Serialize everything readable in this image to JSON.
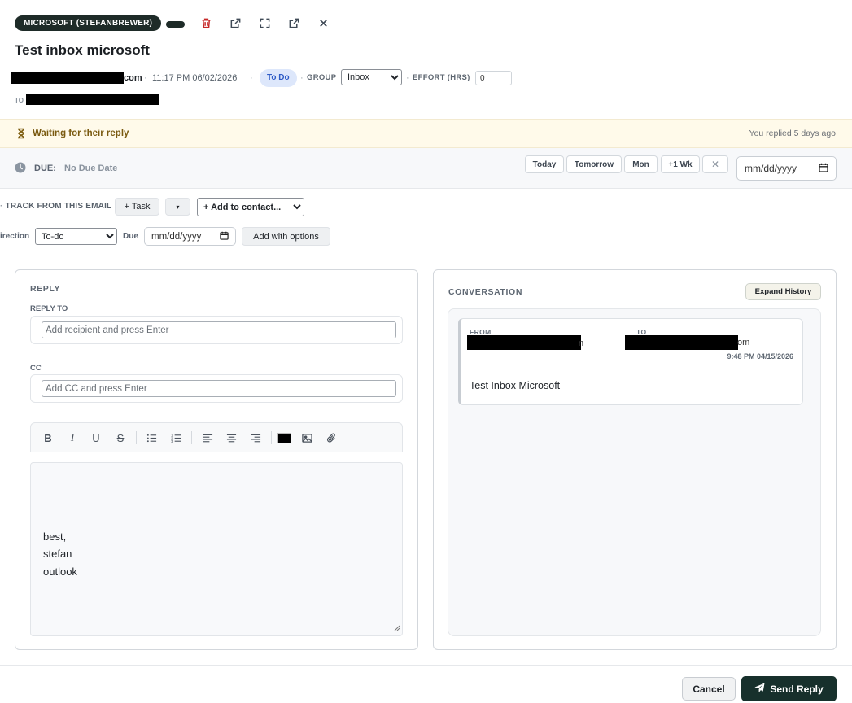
{
  "header": {
    "account_label": "MICROSOFT (STEFANBREWER)",
    "subject": "Test inbox microsoft",
    "sender_suffix": "com",
    "sent_time": "11:17 PM 06/02/2026",
    "status": "To Do",
    "group_label": "GROUP",
    "group_value": "Inbox",
    "group_options": [
      "Inbox"
    ],
    "effort_label": "EFFORT (HRS)",
    "effort_value": "0",
    "to_label": "TO"
  },
  "icons": [
    "delete-icon",
    "open-external-icon",
    "fullscreen-icon",
    "popout-icon",
    "close-icon"
  ],
  "banner": {
    "text": "Waiting for their reply",
    "right_text": "You replied 5 days ago",
    "color": "#7a5a10",
    "background": "#fffaea"
  },
  "due": {
    "label": "DUE:",
    "value": "No Due Date",
    "quick_buttons": [
      "Today",
      "Tomorrow",
      "Mon",
      "+1 Wk"
    ],
    "clear_symbol": "✕",
    "date_placeholder": "mm/dd/yyyy"
  },
  "track": {
    "label": "TRACK FROM THIS EMAIL",
    "task_button": "+ Task",
    "caret_button": "▾",
    "contact_select": "+ Add to contact...",
    "direction_label": "irection",
    "direction_value": "To-do",
    "due_label": "Due",
    "due_placeholder": "mm/dd/yyyy",
    "options_button": "Add with options"
  },
  "reply": {
    "title": "REPLY",
    "reply_to_label": "REPLY TO",
    "reply_to_placeholder": "Add recipient and press Enter",
    "cc_label": "CC",
    "cc_placeholder": "Add CC and press Enter",
    "toolbar": [
      "B",
      "I",
      "U",
      "S"
    ],
    "body_lines": [
      "best,",
      "stefan",
      "outlook"
    ],
    "text_color": "#000000"
  },
  "conversation": {
    "title": "CONVERSATION",
    "expand_button": "Expand History",
    "from_label": "FROM",
    "to_label": "TO",
    "from_suffix": "n",
    "to_suffix": "om",
    "time": "9:48 PM 04/15/2026",
    "message": "Test Inbox Microsoft"
  },
  "footer": {
    "cancel": "Cancel",
    "send": "Send Reply"
  },
  "colors": {
    "accent_dark": "#17302c",
    "status_blue": "#2f5cc7",
    "status_bg": "#dde7fb",
    "danger": "#c62828"
  }
}
